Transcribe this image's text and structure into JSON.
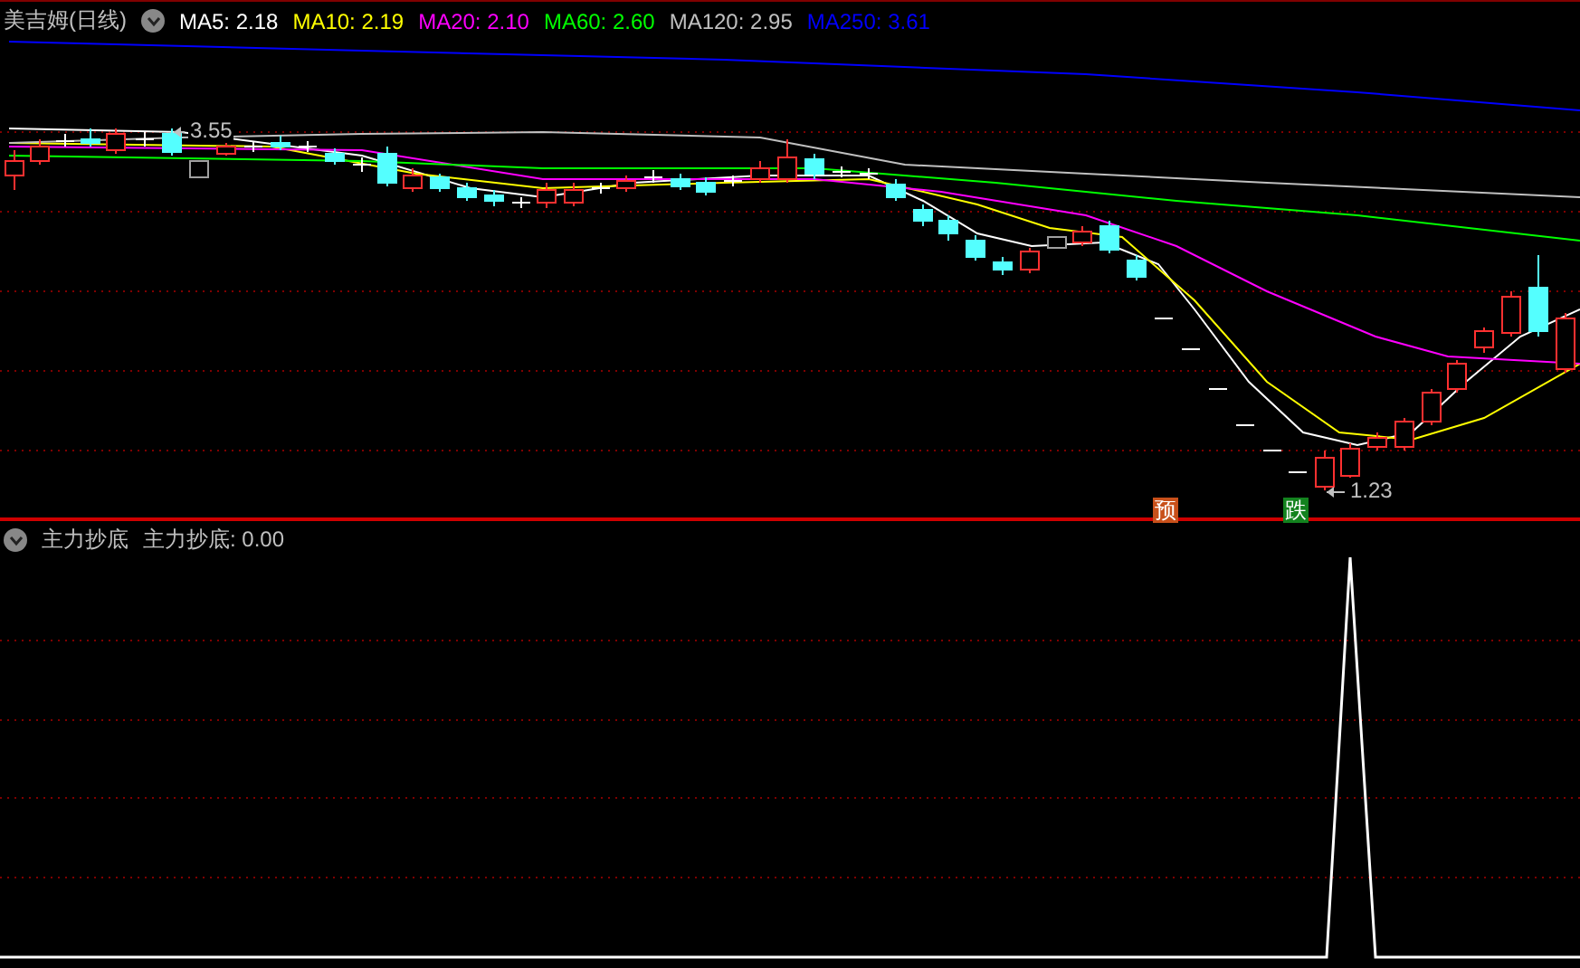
{
  "header": {
    "title": "美吉姆(日线)",
    "indicators": [
      {
        "label": "MA5: 2.18",
        "color": "#ffffff"
      },
      {
        "label": "MA10: 2.19",
        "color": "#ffff00"
      },
      {
        "label": "MA20: 2.10",
        "color": "#ff00ff"
      },
      {
        "label": "MA60: 2.60",
        "color": "#00ff00"
      },
      {
        "label": "MA120: 2.95",
        "color": "#c0c0c0"
      },
      {
        "label": "MA250: 3.61",
        "color": "#0000ff"
      }
    ]
  },
  "main_chart": {
    "annotations": [
      {
        "kind": "price",
        "text": "3.55"
      },
      {
        "kind": "price",
        "text": "1.23"
      },
      {
        "kind": "badge",
        "text": "预",
        "color": "#c8501a"
      },
      {
        "kind": "badge",
        "text": "跌",
        "color": "#13821e"
      }
    ]
  },
  "indicator_pane": {
    "title": "主力抄底",
    "reading": "主力抄底: 0.00"
  }
}
